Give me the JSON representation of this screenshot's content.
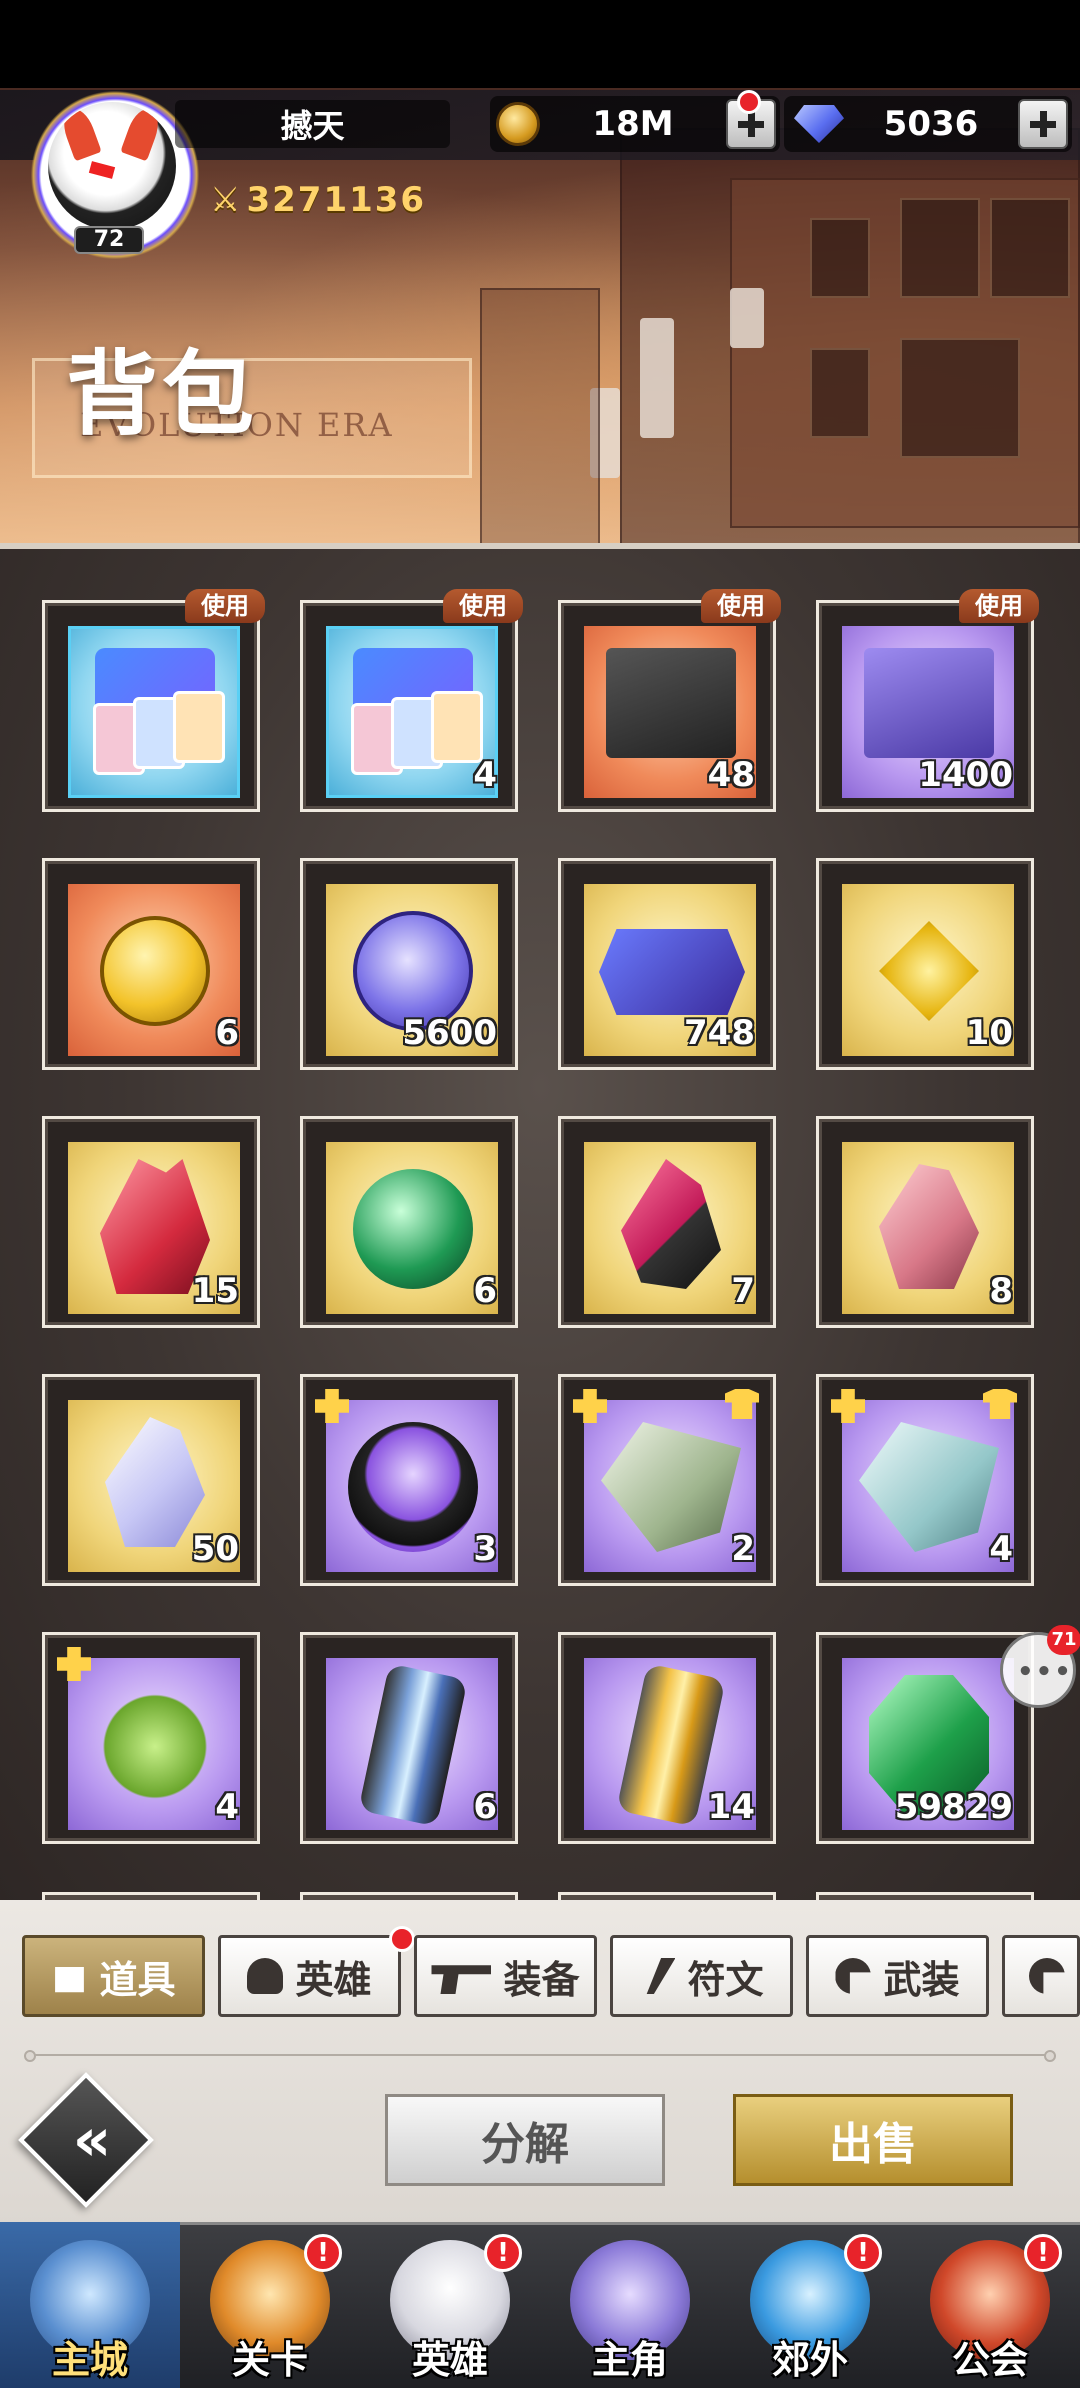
{
  "header": {
    "player_name": "撼天",
    "level": "72",
    "power": "3271136",
    "gold": "18M",
    "diamonds": "5036",
    "page_title": "背包",
    "page_subtitle": "EVOLUTION ERA"
  },
  "inventory": {
    "use_label": "使用",
    "items": [
      {
        "name": "hero-card-pack-blue",
        "count": "",
        "bg": "cyan",
        "use": true
      },
      {
        "name": "hero-card-pack-gold",
        "count": "4",
        "bg": "cyan",
        "use": true
      },
      {
        "name": "gem-supply-box",
        "count": "48",
        "bg": "orange",
        "use": true
      },
      {
        "name": "purple-supply-box",
        "count": "1400",
        "bg": "purple",
        "use": true
      },
      {
        "name": "gold-medal",
        "count": "6",
        "bg": "orange"
      },
      {
        "name": "moon-coin",
        "count": "5600",
        "bg": "gold"
      },
      {
        "name": "recruit-ticket",
        "count": "748",
        "bg": "gold"
      },
      {
        "name": "gold-candy",
        "count": "10",
        "bg": "gold"
      },
      {
        "name": "red-crystal",
        "count": "15",
        "bg": "gold"
      },
      {
        "name": "green-core",
        "count": "6",
        "bg": "gold"
      },
      {
        "name": "dark-crystal",
        "count": "7",
        "bg": "gold"
      },
      {
        "name": "pink-crystal",
        "count": "8",
        "bg": "gold"
      },
      {
        "name": "white-crystal",
        "count": "50",
        "bg": "gold"
      },
      {
        "name": "purple-orb-fragment",
        "count": "3",
        "bg": "purple"
      },
      {
        "name": "green-armor-shard",
        "count": "2",
        "bg": "purple"
      },
      {
        "name": "blue-armor-shard",
        "count": "4",
        "bg": "purple"
      },
      {
        "name": "robot-fragment",
        "count": "4",
        "bg": "purple"
      },
      {
        "name": "blue-energy-tube",
        "count": "6",
        "bg": "purple"
      },
      {
        "name": "gold-energy-tube",
        "count": "14",
        "bg": "purple"
      },
      {
        "name": "emerald-gem",
        "count": "59829",
        "bg": "purple"
      }
    ]
  },
  "chat": {
    "badge": "71"
  },
  "tabs": [
    {
      "label": "道具",
      "icon": "bag-icon",
      "active": true
    },
    {
      "label": "英雄",
      "icon": "helmet-icon",
      "badge": true
    },
    {
      "label": "装备",
      "icon": "pistol-icon"
    },
    {
      "label": "符文",
      "icon": "feather-icon"
    },
    {
      "label": "武装",
      "icon": "swirl-icon"
    }
  ],
  "actions": {
    "decompose": "分解",
    "sell": "出售"
  },
  "nav": [
    {
      "label": "主城",
      "active": true,
      "alert": false
    },
    {
      "label": "关卡",
      "alert": true
    },
    {
      "label": "英雄",
      "alert": true
    },
    {
      "label": "主角",
      "alert": false
    },
    {
      "label": "郊外",
      "alert": true
    },
    {
      "label": "公会",
      "alert": true
    }
  ],
  "alert_mark": "!",
  "colors": {
    "accent_gold": "#b58f2e",
    "alert_red": "#e8232a",
    "panel_bg": "#3d3532"
  }
}
